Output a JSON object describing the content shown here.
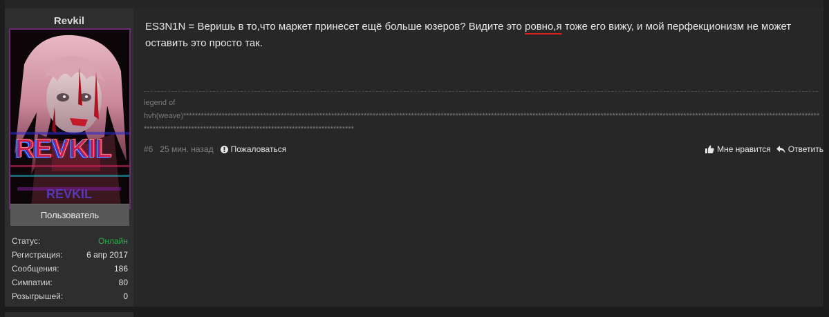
{
  "user": {
    "username": "Revkil",
    "avatar_text": "REVKIL",
    "role_label": "Пользователь",
    "stats": [
      {
        "label": "Статус:",
        "value": "Онлайн"
      },
      {
        "label": "Регистрация:",
        "value": "6 апр 2017"
      },
      {
        "label": "Сообщения:",
        "value": "186"
      },
      {
        "label": "Симпатии:",
        "value": "80"
      },
      {
        "label": "Розыгрышей:",
        "value": "0"
      }
    ]
  },
  "post": {
    "message_before": "ES3N1N = Веришь в то,что маркет принесет ещё больше юзеров? Видите это ",
    "message_misspelled": "ровно,я",
    "message_after": " тоже его вижу, и мой перфекционизм не может оставить это просто так.",
    "signature_line1": "legend of",
    "signature_line2": "hvh(weave)**********************************************************************************************************************************************************************************************************************************************************************************************",
    "number": "#6",
    "time": "25 мин. назад",
    "report_label": "Пожаловаться",
    "like_label": "Мне нравится",
    "reply_label": "Ответить"
  },
  "colors": {
    "online": "#2bb24c",
    "spellcheck_underline": "#d22020",
    "avatar_border": "#6b2a72"
  },
  "icons": {
    "report": "exclamation-circle-icon",
    "like": "thumbs-up-icon",
    "reply": "reply-arrow-icon"
  }
}
